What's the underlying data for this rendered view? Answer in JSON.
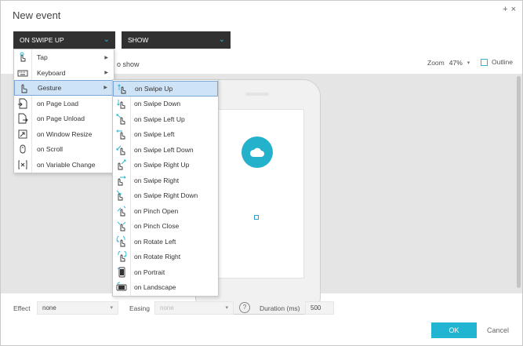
{
  "dialog": {
    "title": "New event",
    "add_icon": "+",
    "close_icon": "×"
  },
  "event_select": {
    "value": "ON SWIPE UP",
    "chevron": "⌄"
  },
  "action_select": {
    "value": "SHOW",
    "chevron": "⌄"
  },
  "hint_text": "o show",
  "zoom": {
    "label": "Zoom",
    "value": "47%",
    "caret": "▾"
  },
  "outline": {
    "label": "Outline"
  },
  "event_menu": {
    "items": [
      {
        "label": "Tap",
        "icon": "tap-icon",
        "submenu": true
      },
      {
        "label": "Keyboard",
        "icon": "keyboard-icon",
        "submenu": true
      },
      {
        "label": "Gesture",
        "icon": "gesture-icon",
        "submenu": true,
        "selected": true
      },
      {
        "label": "on Page Load",
        "icon": "page-load-icon"
      },
      {
        "label": "on Page Unload",
        "icon": "page-unload-icon"
      },
      {
        "label": "on Window Resize",
        "icon": "resize-icon"
      },
      {
        "label": "on Scroll",
        "icon": "scroll-icon"
      },
      {
        "label": "on Variable Change",
        "icon": "variable-icon"
      }
    ],
    "submenu_arrow": "▶"
  },
  "gesture_menu": {
    "items": [
      {
        "label": "on Swipe Up",
        "icon": "swipe-up-icon",
        "selected": true
      },
      {
        "label": "on Swipe Down",
        "icon": "swipe-down-icon"
      },
      {
        "label": "on Swipe Left Up",
        "icon": "swipe-left-up-icon"
      },
      {
        "label": "on Swipe Left",
        "icon": "swipe-left-icon"
      },
      {
        "label": "on Swipe Left Down",
        "icon": "swipe-left-down-icon"
      },
      {
        "label": "on Swipe Right Up",
        "icon": "swipe-right-up-icon"
      },
      {
        "label": "on Swipe Right",
        "icon": "swipe-right-icon"
      },
      {
        "label": "on Swipe Right Down",
        "icon": "swipe-right-down-icon"
      },
      {
        "label": "on Pinch Open",
        "icon": "pinch-open-icon"
      },
      {
        "label": "on Pinch Close",
        "icon": "pinch-close-icon"
      },
      {
        "label": "on Rotate Left",
        "icon": "rotate-left-icon"
      },
      {
        "label": "on Rotate Right",
        "icon": "rotate-right-icon"
      },
      {
        "label": "on Portrait",
        "icon": "portrait-icon"
      },
      {
        "label": "on Landscape",
        "icon": "landscape-icon"
      }
    ]
  },
  "footer": {
    "effect_label": "Effect",
    "effect_value": "none",
    "easing_label": "Easing",
    "easing_value": "none",
    "help_icon": "?",
    "duration_label": "Duration (ms)",
    "duration_value": "500",
    "caret": "▾"
  },
  "buttons": {
    "ok": "OK",
    "cancel": "Cancel"
  },
  "colors": {
    "accent": "#22b5d1",
    "dark": "#313131",
    "selection": "#cfe3f7"
  }
}
